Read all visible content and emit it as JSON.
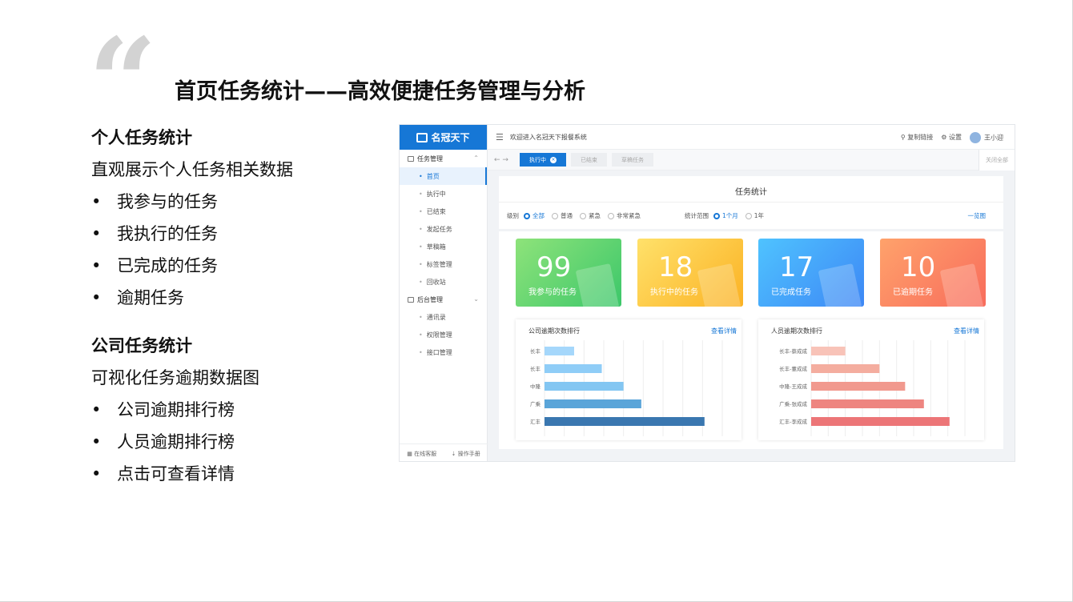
{
  "slide": {
    "title": "首页任务统计——高效便捷任务管理与分析",
    "sections": [
      {
        "heading": "个人任务统计",
        "desc": "直观展示个人任务相关数据",
        "bullets": [
          "我参与的任务",
          "我执行的任务",
          "已完成的任务",
          "逾期任务"
        ]
      },
      {
        "heading": "公司任务统计",
        "desc": "可视化任务逾期数据图",
        "bullets": [
          "公司逾期排行榜",
          "人员逾期排行榜",
          "点击可查看详情"
        ]
      }
    ],
    "bullet_char": "•"
  },
  "app": {
    "logo": "名冠天下",
    "welcome": "欢迎进入名冠天下报餐系统",
    "top_actions": {
      "copy_link": "复制链接",
      "settings": "设置",
      "user": "王小迎"
    },
    "sidebar": {
      "group1": "任务管理",
      "group1_items": [
        "首页",
        "执行中",
        "已结束",
        "发起任务",
        "草稿箱",
        "标签管理",
        "回收站"
      ],
      "group2": "后台管理",
      "group2_items": [
        "通讯录",
        "权限管理",
        "接口管理"
      ],
      "footer": [
        "在线客服",
        "操作手册"
      ]
    },
    "tabs": [
      "执行中",
      "已结束",
      "草稿任务"
    ],
    "close_all": "关闭全部",
    "panel_title": "任务统计",
    "filters": {
      "level_label": "级别",
      "levels": [
        "全部",
        "普通",
        "紧急",
        "非常紧急"
      ],
      "range_label": "统计范围",
      "ranges": [
        "1个月",
        "1年"
      ],
      "overview": "一览图"
    },
    "cards": [
      {
        "value": "99",
        "label": "我参与的任务"
      },
      {
        "value": "18",
        "label": "执行中的任务"
      },
      {
        "value": "17",
        "label": "已完成任务"
      },
      {
        "value": "10",
        "label": "已逾期任务"
      }
    ],
    "colors": {
      "accent": "#1677d6"
    }
  },
  "chart_data": [
    {
      "type": "bar",
      "orientation": "horizontal",
      "title": "公司逾期次数排行",
      "link": "查看详情",
      "categories": [
        "长丰",
        "长丰",
        "中隆",
        "广乘",
        "汇丰"
      ],
      "values": [
        15,
        29,
        40,
        49,
        81
      ],
      "xlim": [
        0,
        90
      ],
      "xticks": [
        "0",
        "10",
        "20",
        "30",
        "40",
        "50",
        "60",
        "70",
        "80",
        "90"
      ],
      "colors": [
        "#a5d7fb",
        "#8fcdf7",
        "#83c6f2",
        "#5aa5d9",
        "#3a77b0"
      ]
    },
    {
      "type": "bar",
      "orientation": "horizontal",
      "title": "人员逾期次数排行",
      "link": "查看详情",
      "categories": [
        "长丰-蔡成成",
        "长丰-董成成",
        "中隆-王成成",
        "广乘-张成成",
        "汇丰-李成成"
      ],
      "values": [
        20,
        40,
        55,
        66,
        81
      ],
      "xlim": [
        0,
        90
      ],
      "xticks": [
        "0",
        "10",
        "20",
        "30",
        "40",
        "50",
        "60",
        "70",
        "80",
        "90"
      ],
      "colors": [
        "#f8c3b8",
        "#f4ad9f",
        "#f1998e",
        "#ee8580",
        "#ec7577"
      ]
    }
  ]
}
